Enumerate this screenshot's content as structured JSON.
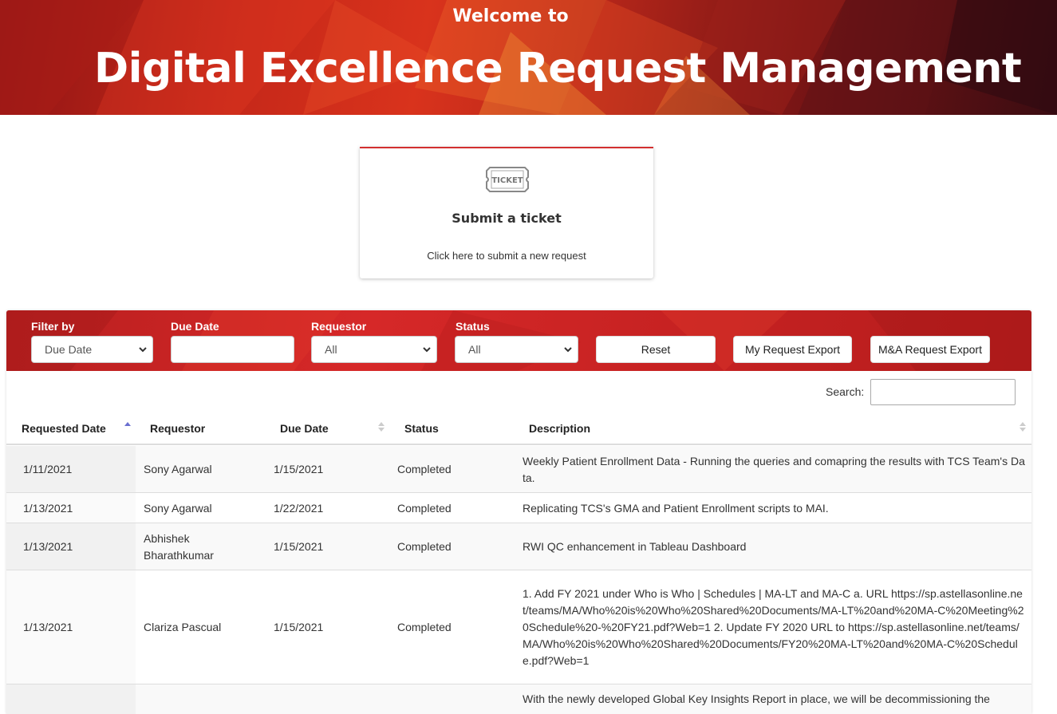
{
  "header": {
    "welcome": "Welcome to",
    "title": "Digital Excellence Request Management"
  },
  "ticket_card": {
    "icon_label": "TICKET",
    "title": "Submit a ticket",
    "subtitle": "Click here to submit a new request"
  },
  "filters": {
    "filter_by_label": "Filter by",
    "filter_by_value": "Due Date",
    "due_date_label": "Due Date",
    "due_date_value": "",
    "requestor_label": "Requestor",
    "requestor_value": "All",
    "status_label": "Status",
    "status_value": "All",
    "reset_label": "Reset",
    "my_export_label": "My Request Export",
    "ma_export_label": "M&A Request Export"
  },
  "search": {
    "label": "Search:",
    "value": ""
  },
  "table": {
    "columns": [
      "Requested Date",
      "Requestor",
      "Due Date",
      "Status",
      "Description"
    ],
    "rows": [
      {
        "requested_date": "1/11/2021",
        "requestor": "Sony Agarwal",
        "due_date": "1/15/2021",
        "status": "Completed",
        "description": "Weekly Patient Enrollment Data - Running the queries and comapring the results with TCS Team's Data."
      },
      {
        "requested_date": "1/13/2021",
        "requestor": "Sony Agarwal",
        "due_date": "1/22/2021",
        "status": "Completed",
        "description": "Replicating TCS's GMA and Patient Enrollment scripts to MAI."
      },
      {
        "requested_date": "1/13/2021",
        "requestor": "Abhishek Bharathkumar",
        "due_date": "1/15/2021",
        "status": "Completed",
        "description": "RWI QC enhancement in Tableau Dashboard"
      },
      {
        "requested_date": "1/13/2021",
        "requestor": "Clariza Pascual",
        "due_date": "1/15/2021",
        "status": "Completed",
        "description": "1. Add FY 2021 under Who is Who | Schedules | MA-LT and MA-C a. URL https://sp.astellasonline.net/teams/MA/Who%20is%20Who%20Shared%20Documents/MA-LT%20and%20MA-C%20Meeting%20Schedule%20-%20FY21.pdf?Web=1 2. Update FY 2020 URL to https://sp.astellasonline.net/teams/MA/Who%20is%20Who%20Shared%20Documents/FY20%20MA-LT%20and%20MA-C%20Schedule.pdf?Web=1"
      },
      {
        "requested_date": "",
        "requestor": "",
        "due_date": "",
        "status": "",
        "description": "With the newly developed Global Key Insights Report in place, we will be decommissioning the"
      }
    ]
  },
  "colors": {
    "banner_red": "#c42719",
    "filter_red": "#d62828",
    "accent_border": "#d32f2f",
    "sort_active": "#6a6fd0"
  }
}
